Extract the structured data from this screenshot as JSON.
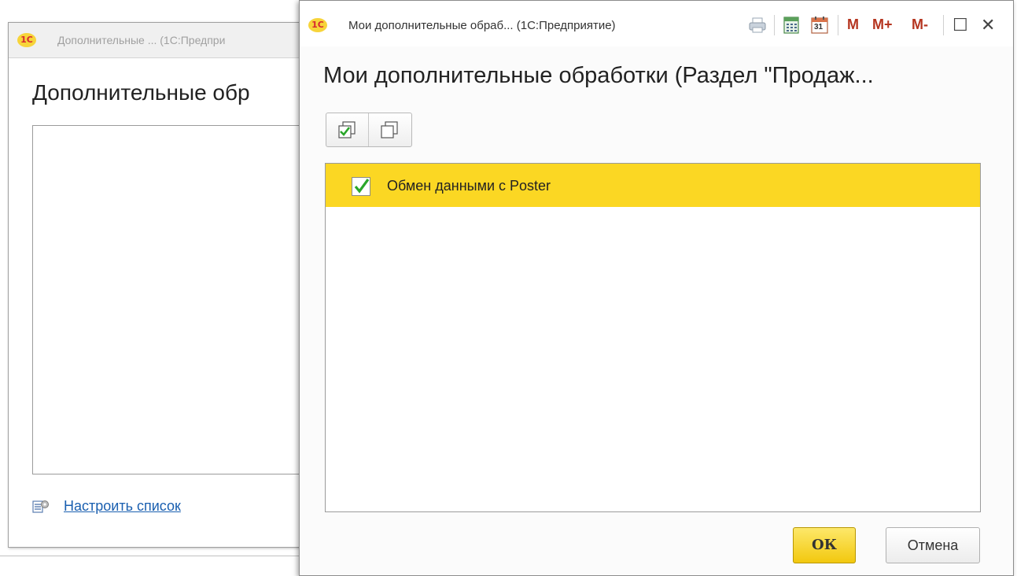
{
  "background_window": {
    "logo_text": "1C",
    "title": "Дополнительные ... (1С:Предпри",
    "heading": "Дополнительные обр",
    "link_icon": "list-settings-icon",
    "link_label": "Настроить список"
  },
  "dialog": {
    "logo_text": "1C",
    "title": "Мои дополнительные обраб... (1С:Предприятие)",
    "heading": "Мои дополнительные обработки (Раздел \"Продаж...",
    "toolbar": {
      "icons": [
        "print-icon",
        "calculator-icon",
        "calendar-icon"
      ],
      "calendar_day": "31",
      "memory_buttons": [
        "M",
        "M+",
        "M-"
      ],
      "maximize_glyph": "☐",
      "close_glyph": "✕"
    },
    "commands": [
      {
        "name": "check-all",
        "icon": "check-all-icon"
      },
      {
        "name": "uncheck-all",
        "icon": "uncheck-all-icon"
      }
    ],
    "list": {
      "items": [
        {
          "label": "Обмен данными с Poster",
          "checked": true,
          "selected": true
        }
      ]
    },
    "buttons": {
      "ok": "ОК",
      "cancel": "Отмена"
    }
  },
  "colors": {
    "selection": "#fbd723",
    "accent_ok": "#f2c80e",
    "link": "#1a5fb0",
    "memory_buttons": "#b5341f",
    "check": "#2aa62a"
  }
}
